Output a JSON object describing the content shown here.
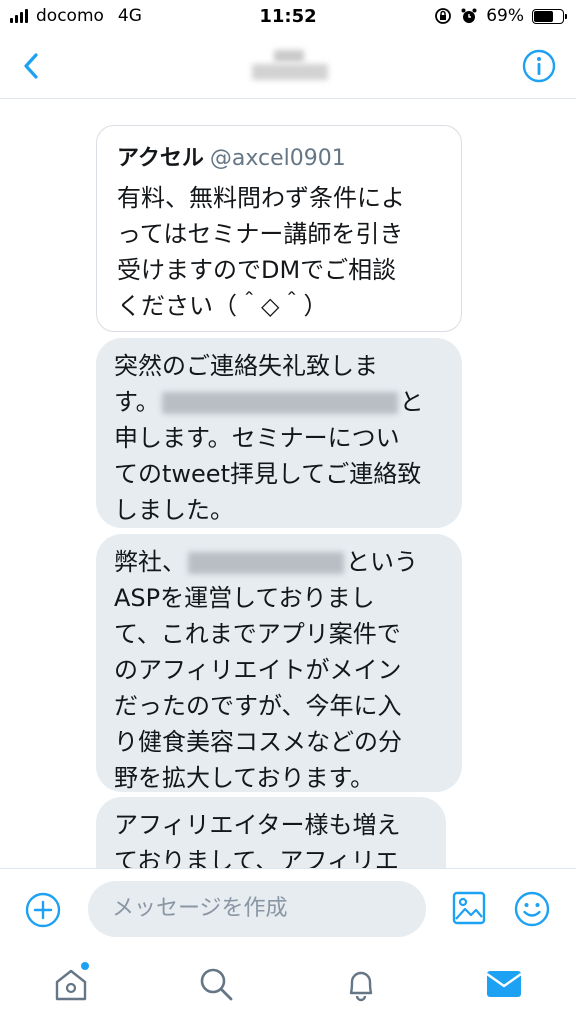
{
  "colors": {
    "accent": "#1da1f2",
    "bubble": "#e6ecf0",
    "text": "#14171a",
    "muted": "#657786"
  },
  "status_bar": {
    "carrier": "docomo",
    "network": "4G",
    "time": "11:52",
    "battery": "69%",
    "battery_level": 0.69
  },
  "nav": {
    "back_icon": "chevron-left-icon",
    "info_icon": "info-icon"
  },
  "quote": {
    "name": "アクセル",
    "handle": "@axcel0901",
    "lines": [
      "有料、無料問わず条件によ",
      "ってはセミナー講師を引き",
      "受けますのでDMでご相談",
      "ください（＾◇＾）"
    ]
  },
  "messages": [
    {
      "lines": [
        "突然のご連絡失礼致しま",
        "す。",
        "と",
        "申します。セミナーについ",
        "てのtweet拝見してご連絡致",
        "しました。"
      ]
    },
    {
      "lines": [
        "弊社、",
        "という",
        "ASPを運営しておりまし",
        "て、これまでアプリ案件で",
        "のアフィリエイトがメイン",
        "だったのですが、今年に入",
        "り健食美容コスメなどの分",
        "野を拡大しております。"
      ]
    },
    {
      "lines": [
        "アフィリエイター様も増え",
        "ておりまして、アフィリエ"
      ]
    }
  ],
  "composer": {
    "placeholder": "メッセージを作成"
  },
  "tabs": [
    "home-icon",
    "search-icon",
    "notifications-icon",
    "messages-icon"
  ]
}
